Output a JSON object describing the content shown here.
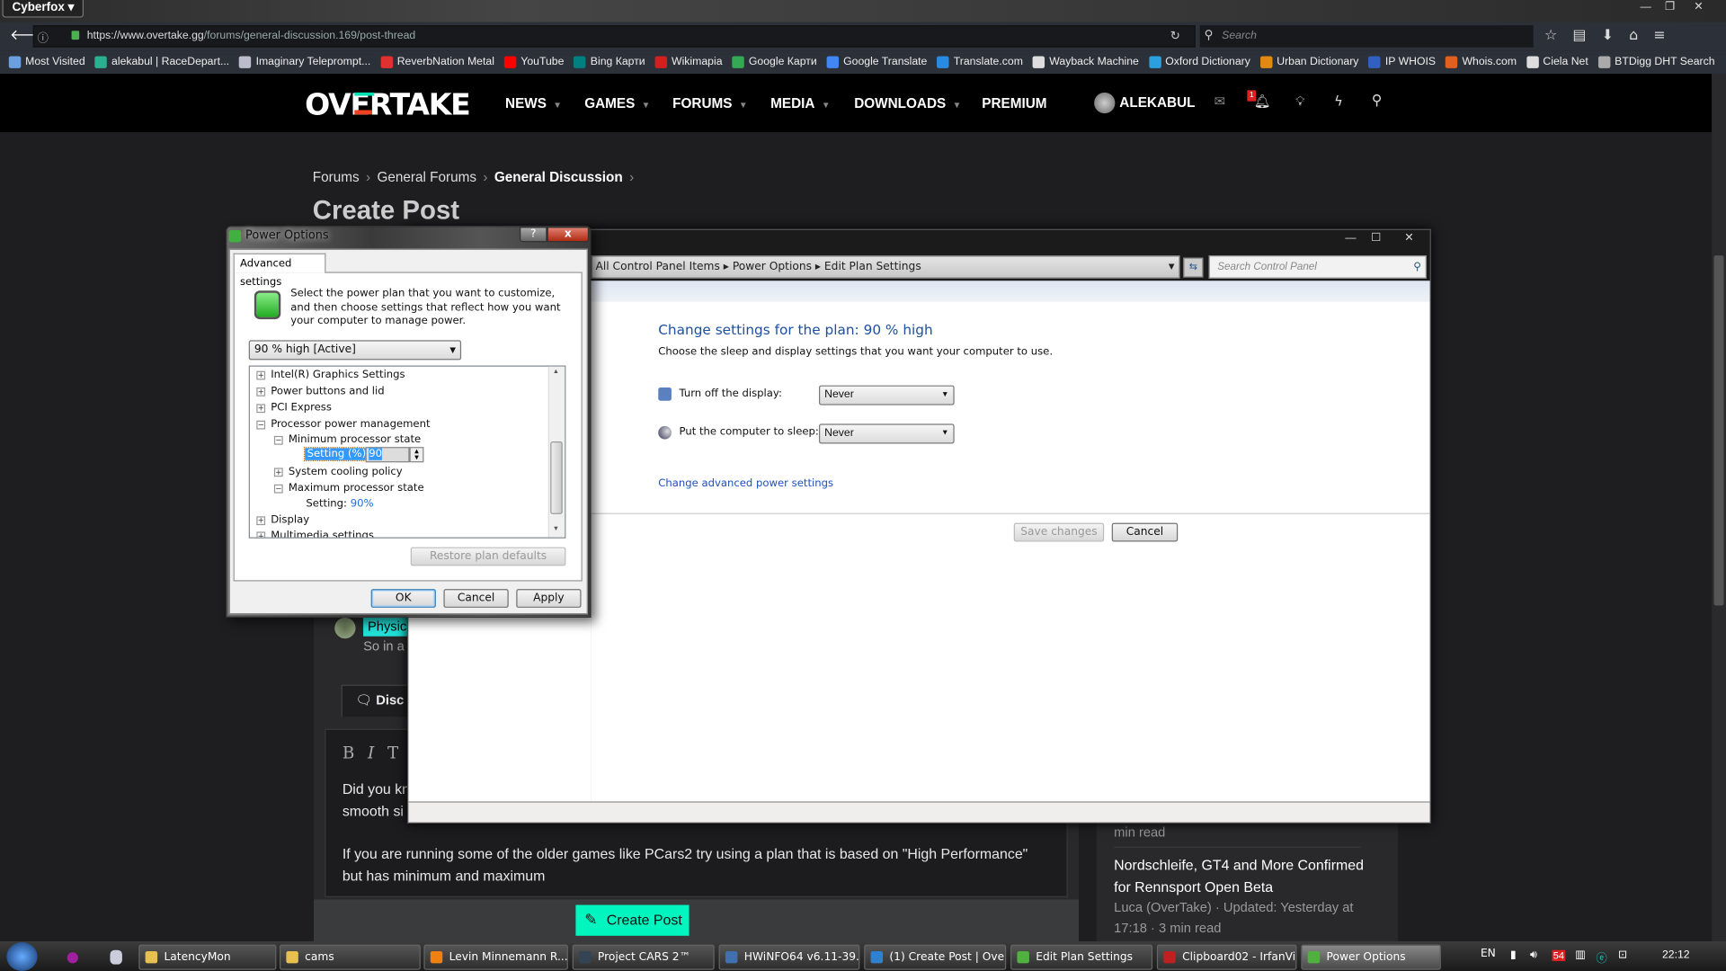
{
  "browser": {
    "app_button": "Cyberfox",
    "url_host": "https://www.overtake.gg",
    "url_path": "/forums/general-discussion.169/post-thread",
    "search_placeholder": "Search",
    "bookmarks": [
      {
        "label": "Most Visited",
        "color": "#6aa0e0"
      },
      {
        "label": "alekabul | RaceDepart...",
        "color": "#2ab090"
      },
      {
        "label": "Imaginary Teleprompt...",
        "color": "#bbbbcc"
      },
      {
        "label": "ReverbNation Metal",
        "color": "#e03030"
      },
      {
        "label": "YouTube",
        "color": "#ff0000"
      },
      {
        "label": "Bing Карти",
        "color": "#008080"
      },
      {
        "label": "Wikimapia",
        "color": "#d02020"
      },
      {
        "label": "Google Карти",
        "color": "#34a853"
      },
      {
        "label": "Google Translate",
        "color": "#4285f4"
      },
      {
        "label": "Translate.com",
        "color": "#2a8ae0"
      },
      {
        "label": "Wayback Machine",
        "color": "#dddddd"
      },
      {
        "label": "Oxford Dictionary",
        "color": "#2aa0e0"
      },
      {
        "label": "Urban Dictionary",
        "color": "#e08a10"
      },
      {
        "label": "IP WHOIS",
        "color": "#3060c0"
      },
      {
        "label": "Whois.com",
        "color": "#e06020"
      },
      {
        "label": "Ciela Net",
        "color": "#dddddd"
      },
      {
        "label": "BTDigg DHT Search",
        "color": "#aaaaaa"
      }
    ]
  },
  "site": {
    "logo": "OVERTAKE",
    "nav": [
      "NEWS",
      "GAMES",
      "FORUMS",
      "MEDIA",
      "DOWNLOADS",
      "PREMIUM"
    ],
    "username": "ALEKABUL",
    "notif_count": "1",
    "accent": "#00f5bf",
    "breadcrumb": [
      "Forums",
      "General Forums",
      "General Discussion"
    ],
    "page_title": "Create Post",
    "preview_tag": "Physics",
    "preview_text": "So in a",
    "tab_label": "Disc",
    "editor_tools": [
      "B",
      "I",
      "T"
    ],
    "post_lines": [
      "Did you kn",
      "smooth si",
      "If you are running some of the older games like PCars2 try using a plan that is based on \"High Performance\"",
      "but has minimum and maximum"
    ],
    "create_button": "Create Post",
    "sidebar": {
      "prev_meta": "min read",
      "article_title": "Nordschleife, GT4 and More Confirmed for Rennsport Open Beta",
      "article_meta": "Luca (OverTake) · Updated: Yesterday at 17:18 · 3 min read"
    }
  },
  "edit_plan": {
    "address": [
      "All Control Panel Items",
      "Power Options",
      "Edit Plan Settings"
    ],
    "search_placeholder": "Search Control Panel",
    "heading": "Change settings for the plan: 90 % high",
    "subheading": "Choose the sleep and display settings that you want your computer to use.",
    "display_label": "Turn off the display:",
    "display_value": "Never",
    "sleep_label": "Put the computer to sleep:",
    "sleep_value": "Never",
    "advanced_link": "Change advanced power settings",
    "save_button": "Save changes",
    "cancel_button": "Cancel"
  },
  "power_options": {
    "title": "Power Options",
    "tab": "Advanced settings",
    "help_button": "?",
    "close_button": "x",
    "intro": "Select the power plan that you want to customize, and then choose settings that reflect how you want your computer to manage power.",
    "plan": "90 % high [Active]",
    "tree": [
      "Intel(R) Graphics Settings",
      "Power buttons and lid",
      "PCI Express",
      "Processor power management",
      "Minimum processor state",
      "Setting (%):",
      "System cooling policy",
      "Maximum processor state",
      "Setting:",
      "Display",
      "Multimedia settings"
    ],
    "min_value": "90",
    "max_value": "90%",
    "restore_button": "Restore plan defaults",
    "ok_button": "OK",
    "cancel_button": "Cancel",
    "apply_button": "Apply"
  },
  "taskbar": {
    "items": [
      {
        "label": "LatencyMon",
        "color": "#e8c050"
      },
      {
        "label": "cams",
        "color": "#e8c050"
      },
      {
        "label": "Levin Minnemann R...",
        "color": "#f08010"
      },
      {
        "label": "Project CARS 2™",
        "color": "#334455"
      },
      {
        "label": "HWiNFO64 v6.11-39...",
        "color": "#4070b0"
      },
      {
        "label": "(1) Create Post | Over...",
        "color": "#3080d0"
      },
      {
        "label": "Edit Plan Settings",
        "color": "#50b040"
      },
      {
        "label": "Clipboard02 - IrfanVi...",
        "color": "#c02020"
      },
      {
        "label": "Power Options",
        "color": "#50b040"
      }
    ],
    "lang": "EN",
    "tray_badge": "54",
    "clock": "22:12"
  }
}
